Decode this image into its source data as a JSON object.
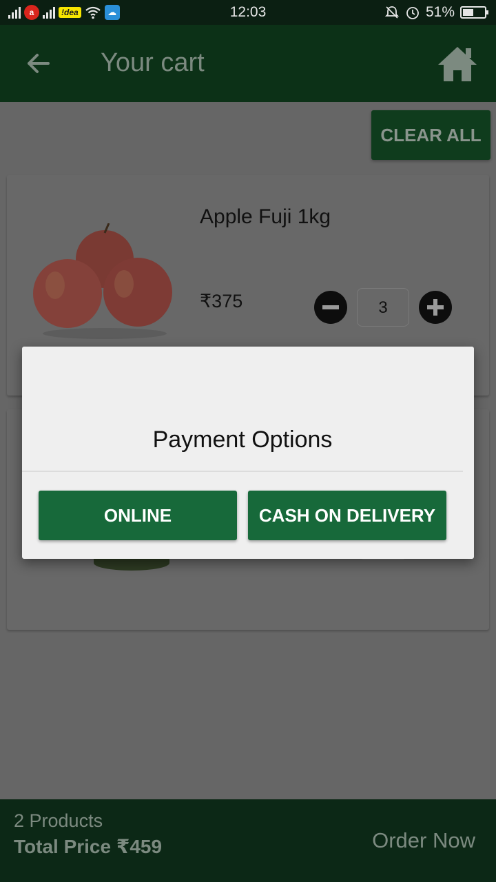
{
  "status_bar": {
    "carrier_badge": "!dea",
    "time": "12:03",
    "battery": "51%",
    "battery_level": 0.51
  },
  "app_bar": {
    "title": "Your cart"
  },
  "cart": {
    "clear_all_label": "CLEAR ALL",
    "items": [
      {
        "name": "Apple Fuji 1kg",
        "price": "₹375",
        "quantity": "3"
      }
    ]
  },
  "bottom_bar": {
    "product_count": "2 Products",
    "total_price": "Total Price ₹459",
    "order_label": "Order Now"
  },
  "dialog": {
    "title": "Payment Options",
    "online_label": "ONLINE",
    "cod_label": "CASH ON DELIVERY"
  },
  "icons": {
    "back": "back-arrow-icon",
    "home": "home-icon",
    "minus": "minus-circle-icon",
    "plus": "plus-circle-icon"
  },
  "colors": {
    "app_bar": "#0c3117",
    "primary_button": "#17693a",
    "dialog_bg": "#efefef",
    "overlay": "#666666"
  }
}
